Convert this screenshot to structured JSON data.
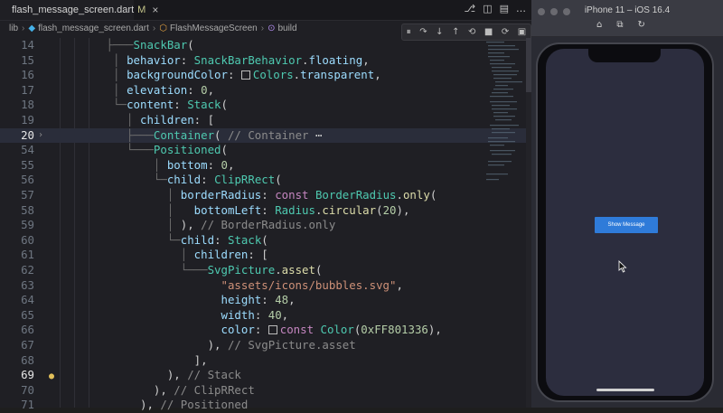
{
  "editor": {
    "tab": {
      "filename": "flash_message_screen.dart",
      "modified": "M",
      "close": "×"
    },
    "tab_actions": [
      "⎇",
      "◫",
      "▤",
      "…"
    ],
    "breadcrumb": [
      "lib",
      "flash_message_screen.dart",
      "FlashMessageScreen",
      "build"
    ],
    "debug_icons": [
      "⏸",
      "↷",
      "↓",
      "↑",
      "⟲",
      "■",
      "⟳",
      "▣"
    ],
    "lines": [
      {
        "n": "14",
        "t": [
          [
            "guide",
            "        ├───"
          ],
          [
            "ty",
            "SnackBar"
          ],
          [
            "",
            "("
          ]
        ]
      },
      {
        "n": "15",
        "t": [
          [
            "guide",
            "         │ "
          ],
          [
            "kw",
            "behavior"
          ],
          [
            "",
            ": "
          ],
          [
            "ty",
            "SnackBarBehavior"
          ],
          [
            "",
            "."
          ],
          [
            "kw",
            "floating"
          ],
          [
            "",
            ","
          ]
        ]
      },
      {
        "n": "16",
        "t": [
          [
            "guide",
            "         │ "
          ],
          [
            "kw",
            "backgroundColor"
          ],
          [
            "",
            ": "
          ],
          [
            "swatch",
            ""
          ],
          [
            "ty",
            "Colors"
          ],
          [
            "",
            "."
          ],
          [
            "kw",
            "transparent"
          ],
          [
            "",
            ","
          ]
        ]
      },
      {
        "n": "17",
        "t": [
          [
            "guide",
            "         │ "
          ],
          [
            "kw",
            "elevation"
          ],
          [
            "",
            ": "
          ],
          [
            "num",
            "0"
          ],
          [
            "",
            ","
          ]
        ]
      },
      {
        "n": "18",
        "t": [
          [
            "guide",
            "         └─"
          ],
          [
            "kw",
            "content"
          ],
          [
            "",
            ": "
          ],
          [
            "ty",
            "Stack"
          ],
          [
            "",
            "("
          ]
        ]
      },
      {
        "n": "19",
        "t": [
          [
            "guide",
            "           │ "
          ],
          [
            "kw",
            "children"
          ],
          [
            "",
            ": ["
          ]
        ]
      },
      {
        "n": "20",
        "t": [
          [
            "guide",
            "           ├───"
          ],
          [
            "ty",
            "Container"
          ],
          [
            "",
            "( "
          ],
          [
            "cmt",
            "// Container"
          ],
          [
            "",
            " ⋯"
          ]
        ],
        "active": true,
        "chev": true
      },
      {
        "n": "54",
        "t": [
          [
            "guide",
            "           └───"
          ],
          [
            "ty",
            "Positioned"
          ],
          [
            "",
            "("
          ]
        ]
      },
      {
        "n": "55",
        "t": [
          [
            "guide",
            "               │ "
          ],
          [
            "kw",
            "bottom"
          ],
          [
            "",
            ": "
          ],
          [
            "num",
            "0"
          ],
          [
            "",
            ","
          ]
        ]
      },
      {
        "n": "56",
        "t": [
          [
            "guide",
            "               └─"
          ],
          [
            "kw",
            "child"
          ],
          [
            "",
            ": "
          ],
          [
            "ty",
            "ClipRRect"
          ],
          [
            "",
            "("
          ]
        ]
      },
      {
        "n": "57",
        "t": [
          [
            "guide",
            "                 │ "
          ],
          [
            "kw",
            "borderRadius"
          ],
          [
            "",
            ": "
          ],
          [
            "cw",
            "const "
          ],
          [
            "ty",
            "BorderRadius"
          ],
          [
            "",
            "."
          ],
          [
            "fn",
            "only"
          ],
          [
            "",
            "("
          ]
        ]
      },
      {
        "n": "58",
        "t": [
          [
            "guide",
            "                 │   "
          ],
          [
            "kw",
            "bottomLeft"
          ],
          [
            "",
            ": "
          ],
          [
            "ty",
            "Radius"
          ],
          [
            "",
            "."
          ],
          [
            "fn",
            "circular"
          ],
          [
            "",
            "("
          ],
          [
            "num",
            "20"
          ],
          [
            "",
            "),"
          ]
        ]
      },
      {
        "n": "59",
        "t": [
          [
            "guide",
            "                 │ "
          ],
          [
            "",
            "), "
          ],
          [
            "cmt",
            "// BorderRadius.only"
          ]
        ]
      },
      {
        "n": "60",
        "t": [
          [
            "guide",
            "                 └─"
          ],
          [
            "kw",
            "child"
          ],
          [
            "",
            ": "
          ],
          [
            "ty",
            "Stack"
          ],
          [
            "",
            "("
          ]
        ]
      },
      {
        "n": "61",
        "t": [
          [
            "guide",
            "                   │ "
          ],
          [
            "kw",
            "children"
          ],
          [
            "",
            ": ["
          ]
        ]
      },
      {
        "n": "62",
        "t": [
          [
            "guide",
            "                   └───"
          ],
          [
            "ty",
            "SvgPicture"
          ],
          [
            "",
            "."
          ],
          [
            "fn",
            "asset"
          ],
          [
            "",
            "("
          ]
        ]
      },
      {
        "n": "63",
        "t": [
          [
            "guide",
            "                         "
          ],
          [
            "str",
            "\"assets/icons/bubbles.svg\""
          ],
          [
            "",
            ","
          ]
        ]
      },
      {
        "n": "64",
        "t": [
          [
            "guide",
            "                         "
          ],
          [
            "kw",
            "height"
          ],
          [
            "",
            ": "
          ],
          [
            "num",
            "48"
          ],
          [
            "",
            ","
          ]
        ]
      },
      {
        "n": "65",
        "t": [
          [
            "guide",
            "                         "
          ],
          [
            "kw",
            "width"
          ],
          [
            "",
            ": "
          ],
          [
            "num",
            "40"
          ],
          [
            "",
            ","
          ]
        ]
      },
      {
        "n": "66",
        "t": [
          [
            "guide",
            "                         "
          ],
          [
            "kw",
            "color"
          ],
          [
            "",
            ": "
          ],
          [
            "swatch",
            ""
          ],
          [
            "cw",
            "const "
          ],
          [
            "ty",
            "Color"
          ],
          [
            "",
            "("
          ],
          [
            "num",
            "0xFF801336"
          ],
          [
            "",
            "),"
          ]
        ]
      },
      {
        "n": "67",
        "t": [
          [
            "guide",
            "                       "
          ],
          [
            "",
            "), "
          ],
          [
            "cmt",
            "// SvgPicture.asset"
          ]
        ]
      },
      {
        "n": "68",
        "t": [
          [
            "guide",
            "                     "
          ],
          [
            "",
            "],"
          ]
        ]
      },
      {
        "n": "69",
        "t": [
          [
            "guide",
            "                 "
          ],
          [
            "",
            "), "
          ],
          [
            "cmt",
            "// Stack"
          ]
        ],
        "cur": true,
        "bulb": true
      },
      {
        "n": "70",
        "t": [
          [
            "guide",
            "               "
          ],
          [
            "",
            "), "
          ],
          [
            "cmt",
            "// ClipRRect"
          ]
        ]
      },
      {
        "n": "71",
        "t": [
          [
            "guide",
            "             "
          ],
          [
            "",
            "), "
          ],
          [
            "cmt",
            "// Positioned"
          ]
        ]
      }
    ]
  },
  "simulator": {
    "title": "iPhone 11 – iOS 16.4",
    "toolbar_icons": [
      "⌂",
      "⧉",
      "↻"
    ],
    "button_label": "Show Message"
  }
}
